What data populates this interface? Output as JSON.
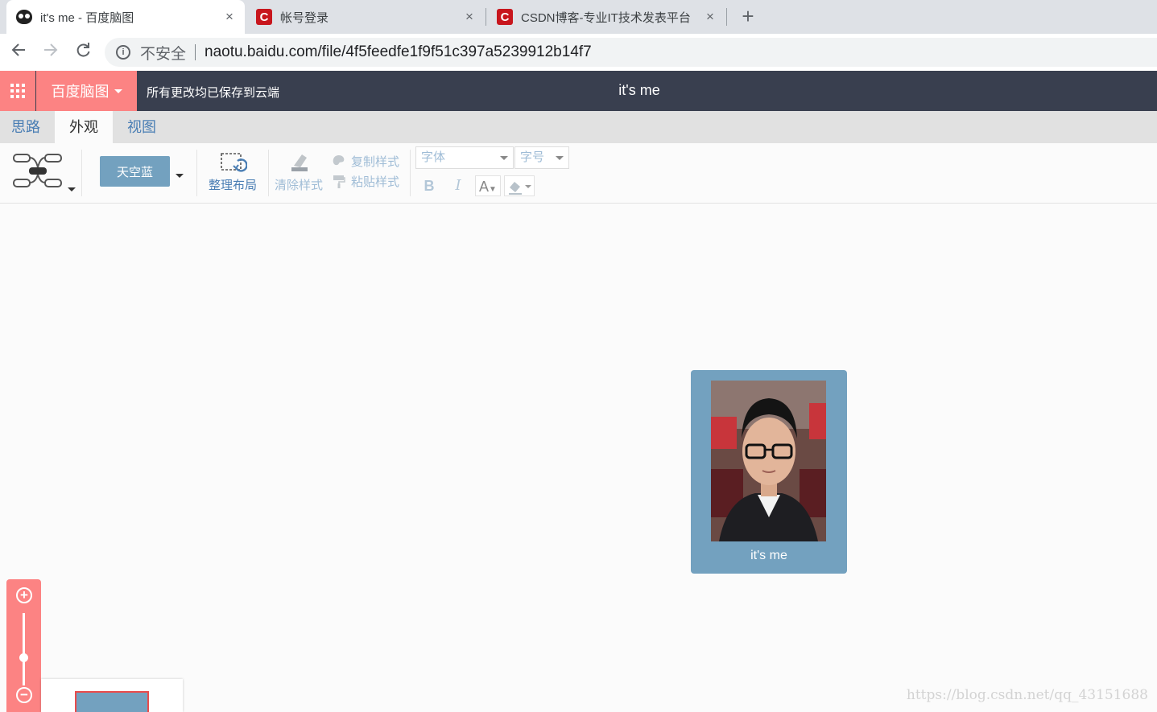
{
  "browser": {
    "tabs": [
      {
        "title": "it's me - 百度脑图",
        "icon": "owl-icon",
        "active": true
      },
      {
        "title": "帐号登录",
        "icon": "csdn-icon",
        "active": false
      },
      {
        "title": "CSDN博客-专业IT技术发表平台",
        "icon": "csdn-icon",
        "active": false
      }
    ],
    "new_tab": "+",
    "close_glyph": "×",
    "security_label": "不安全",
    "url": "naotu.baidu.com/file/4f5feedfe1f9f51c397a5239912b14f7"
  },
  "app": {
    "brand": "百度脑图",
    "save_status": "所有更改均已保存到云端",
    "doc_title": "it's me",
    "accent_color": "#fc8383",
    "header_color": "#393f4f"
  },
  "ribbon_tabs": [
    "思路",
    "外观",
    "视图"
  ],
  "ribbon": {
    "theme": "天空蓝",
    "arrange_layout": "整理布局",
    "clear_style": "清除样式",
    "copy_style": "复制样式",
    "paste_style": "粘贴样式",
    "font_placeholder": "字体",
    "size_placeholder": "字号",
    "bold": "B",
    "italic": "I",
    "font_color": "A"
  },
  "canvas": {
    "node_label": "it's me",
    "node_color": "#73a1bf"
  },
  "zoom": {
    "in": "+",
    "out": "−"
  },
  "watermark": "https://blog.csdn.net/qq_43151688"
}
